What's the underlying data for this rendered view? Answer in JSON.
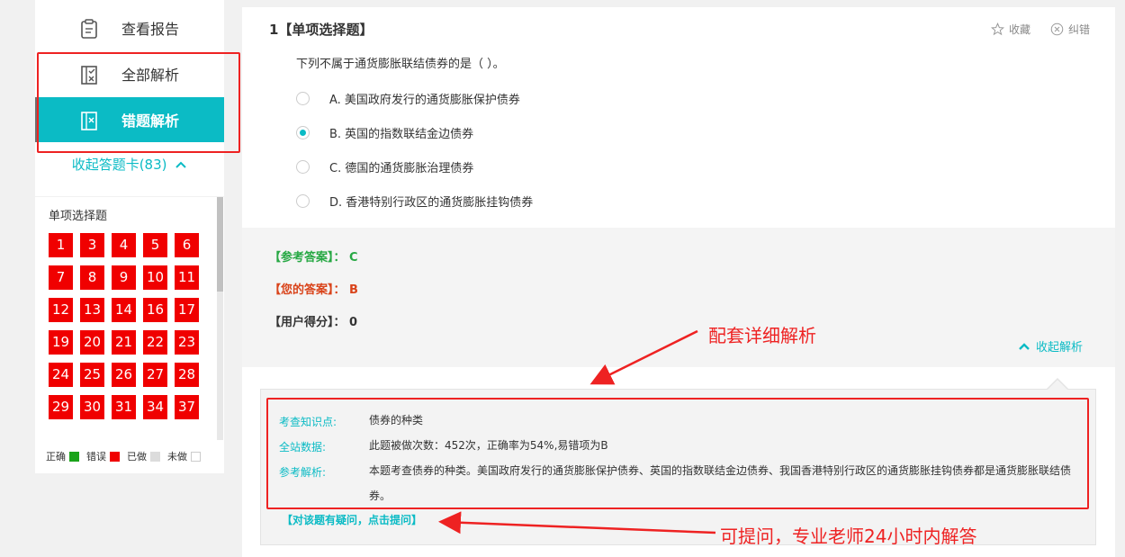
{
  "sidebar": {
    "nav": [
      {
        "label": "查看报告",
        "icon": "report-icon",
        "active": false
      },
      {
        "label": "全部解析",
        "icon": "all-analysis-icon",
        "active": false
      },
      {
        "label": "错题解析",
        "icon": "wrong-analysis-icon",
        "active": true
      }
    ],
    "collapse_label": "收起答题卡(83)",
    "grid_title": "单项选择题",
    "question_numbers": [
      "1",
      "3",
      "4",
      "5",
      "6",
      "7",
      "8",
      "9",
      "10",
      "11",
      "12",
      "13",
      "14",
      "16",
      "17",
      "19",
      "20",
      "21",
      "22",
      "23",
      "24",
      "25",
      "26",
      "27",
      "28",
      "29",
      "30",
      "31",
      "34",
      "37"
    ],
    "legend": [
      {
        "label": "正确",
        "color": "#1aa31a"
      },
      {
        "label": "错误",
        "color": "#f00000"
      },
      {
        "label": "已做",
        "color": "#dcdcdc"
      },
      {
        "label": "未做",
        "color": "#ffffff"
      }
    ]
  },
  "question": {
    "title": "1【单项选择题】",
    "favorite_label": "收藏",
    "report_error_label": "纠错",
    "stem": "下列不属于通货膨胀联结债券的是（    ）。",
    "options": [
      {
        "text": "A.  美国政府发行的通货膨胀保护债券",
        "checked": false
      },
      {
        "text": "B.  英国的指数联结金边债券",
        "checked": true
      },
      {
        "text": "C.  德国的通货膨胀治理债券",
        "checked": false
      },
      {
        "text": "D.  香港特别行政区的通货膨胀挂钩债券",
        "checked": false
      }
    ]
  },
  "answers": {
    "reference": "【参考答案】： C",
    "yours": "【您的答案】： B",
    "score": "【用户得分】：  0",
    "collapse_analysis_label": "收起解析"
  },
  "analysis": {
    "knowledge_key": "考查知识点:",
    "knowledge_val": "债券的种类",
    "stats_key": "全站数据:",
    "stats_val": "此题被做次数：452次，正确率为54%,易错项为B",
    "explain_key": "参考解析:",
    "explain_val": "本题考查债券的种类。美国政府发行的通货膨胀保护债券、英国的指数联结金边债券、我国香港特别行政区的通货膨胀挂钩债券都是通货膨胀联结债券。",
    "ask_label": "【对该题有疑问，点击提问】"
  },
  "annotations": {
    "detail_note": "配套详细解析",
    "ask_note": "可提问，专业老师24小时内解答",
    "color": "#ee2222"
  },
  "colors": {
    "accent": "#0bbbc5",
    "wrong": "#f00000",
    "reference": "#27a844",
    "yours": "#d9431a"
  }
}
